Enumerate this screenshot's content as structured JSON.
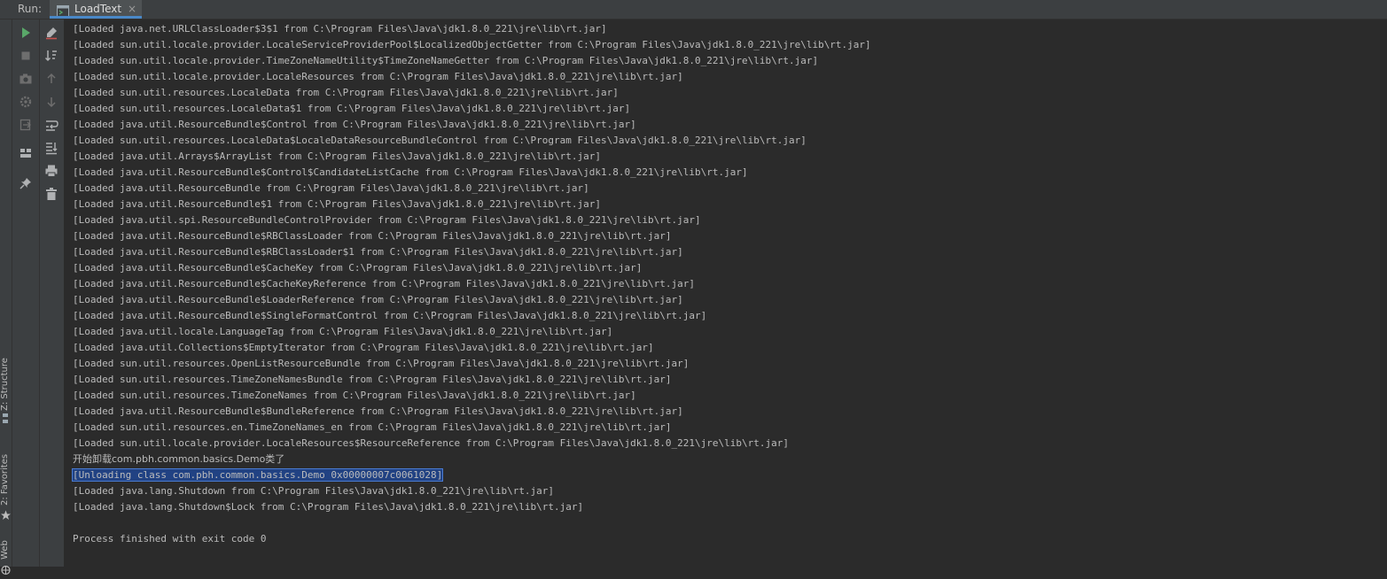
{
  "run": {
    "label": "Run:",
    "tab_label": "LoadText",
    "tab_close": "×"
  },
  "stripe": {
    "structure_label": "Z: Structure",
    "favorites_label": "2: Favorites",
    "web_label": "Web"
  },
  "toolbar1": [
    "run-icon",
    "stop-icon",
    "camera-icon",
    "settings-icon",
    "exit-icon",
    "layout-icon",
    "pin-icon"
  ],
  "toolbar2": [
    "clear-icon",
    "sort-icon",
    "up-arrow-icon",
    "down-arrow-icon",
    "soft-wrap-icon",
    "scroll-to-end-icon",
    "print-icon",
    "trash-icon"
  ],
  "colors": {
    "background": "#2b2b2b",
    "panel": "#3c3f41",
    "text": "#bbbbbb",
    "selection": "#214283",
    "accent": "#4a88c7",
    "run_green": "#59a869"
  },
  "console": {
    "lines": [
      "[Loaded java.net.URLClassLoader$3$1 from C:\\Program Files\\Java\\jdk1.8.0_221\\jre\\lib\\rt.jar]",
      "[Loaded sun.util.locale.provider.LocaleServiceProviderPool$LocalizedObjectGetter from C:\\Program Files\\Java\\jdk1.8.0_221\\jre\\lib\\rt.jar]",
      "[Loaded sun.util.locale.provider.TimeZoneNameUtility$TimeZoneNameGetter from C:\\Program Files\\Java\\jdk1.8.0_221\\jre\\lib\\rt.jar]",
      "[Loaded sun.util.locale.provider.LocaleResources from C:\\Program Files\\Java\\jdk1.8.0_221\\jre\\lib\\rt.jar]",
      "[Loaded sun.util.resources.LocaleData from C:\\Program Files\\Java\\jdk1.8.0_221\\jre\\lib\\rt.jar]",
      "[Loaded sun.util.resources.LocaleData$1 from C:\\Program Files\\Java\\jdk1.8.0_221\\jre\\lib\\rt.jar]",
      "[Loaded java.util.ResourceBundle$Control from C:\\Program Files\\Java\\jdk1.8.0_221\\jre\\lib\\rt.jar]",
      "[Loaded sun.util.resources.LocaleData$LocaleDataResourceBundleControl from C:\\Program Files\\Java\\jdk1.8.0_221\\jre\\lib\\rt.jar]",
      "[Loaded java.util.Arrays$ArrayList from C:\\Program Files\\Java\\jdk1.8.0_221\\jre\\lib\\rt.jar]",
      "[Loaded java.util.ResourceBundle$Control$CandidateListCache from C:\\Program Files\\Java\\jdk1.8.0_221\\jre\\lib\\rt.jar]",
      "[Loaded java.util.ResourceBundle from C:\\Program Files\\Java\\jdk1.8.0_221\\jre\\lib\\rt.jar]",
      "[Loaded java.util.ResourceBundle$1 from C:\\Program Files\\Java\\jdk1.8.0_221\\jre\\lib\\rt.jar]",
      "[Loaded java.util.spi.ResourceBundleControlProvider from C:\\Program Files\\Java\\jdk1.8.0_221\\jre\\lib\\rt.jar]",
      "[Loaded java.util.ResourceBundle$RBClassLoader from C:\\Program Files\\Java\\jdk1.8.0_221\\jre\\lib\\rt.jar]",
      "[Loaded java.util.ResourceBundle$RBClassLoader$1 from C:\\Program Files\\Java\\jdk1.8.0_221\\jre\\lib\\rt.jar]",
      "[Loaded java.util.ResourceBundle$CacheKey from C:\\Program Files\\Java\\jdk1.8.0_221\\jre\\lib\\rt.jar]",
      "[Loaded java.util.ResourceBundle$CacheKeyReference from C:\\Program Files\\Java\\jdk1.8.0_221\\jre\\lib\\rt.jar]",
      "[Loaded java.util.ResourceBundle$LoaderReference from C:\\Program Files\\Java\\jdk1.8.0_221\\jre\\lib\\rt.jar]",
      "[Loaded java.util.ResourceBundle$SingleFormatControl from C:\\Program Files\\Java\\jdk1.8.0_221\\jre\\lib\\rt.jar]",
      "[Loaded java.util.locale.LanguageTag from C:\\Program Files\\Java\\jdk1.8.0_221\\jre\\lib\\rt.jar]",
      "[Loaded java.util.Collections$EmptyIterator from C:\\Program Files\\Java\\jdk1.8.0_221\\jre\\lib\\rt.jar]",
      "[Loaded sun.util.resources.OpenListResourceBundle from C:\\Program Files\\Java\\jdk1.8.0_221\\jre\\lib\\rt.jar]",
      "[Loaded sun.util.resources.TimeZoneNamesBundle from C:\\Program Files\\Java\\jdk1.8.0_221\\jre\\lib\\rt.jar]",
      "[Loaded sun.util.resources.TimeZoneNames from C:\\Program Files\\Java\\jdk1.8.0_221\\jre\\lib\\rt.jar]",
      "[Loaded java.util.ResourceBundle$BundleReference from C:\\Program Files\\Java\\jdk1.8.0_221\\jre\\lib\\rt.jar]",
      "[Loaded sun.util.resources.en.TimeZoneNames_en from C:\\Program Files\\Java\\jdk1.8.0_221\\jre\\lib\\rt.jar]",
      "[Loaded sun.util.locale.provider.LocaleResources$ResourceReference from C:\\Program Files\\Java\\jdk1.8.0_221\\jre\\lib\\rt.jar]",
      "开始卸载com.pbh.common.basics.Demo类了",
      "[Unloading class com.pbh.common.basics.Demo 0x00000007c0061028]",
      "[Loaded java.lang.Shutdown from C:\\Program Files\\Java\\jdk1.8.0_221\\jre\\lib\\rt.jar]",
      "[Loaded java.lang.Shutdown$Lock from C:\\Program Files\\Java\\jdk1.8.0_221\\jre\\lib\\rt.jar]",
      "",
      "Process finished with exit code 0"
    ],
    "selected_line": 28
  }
}
